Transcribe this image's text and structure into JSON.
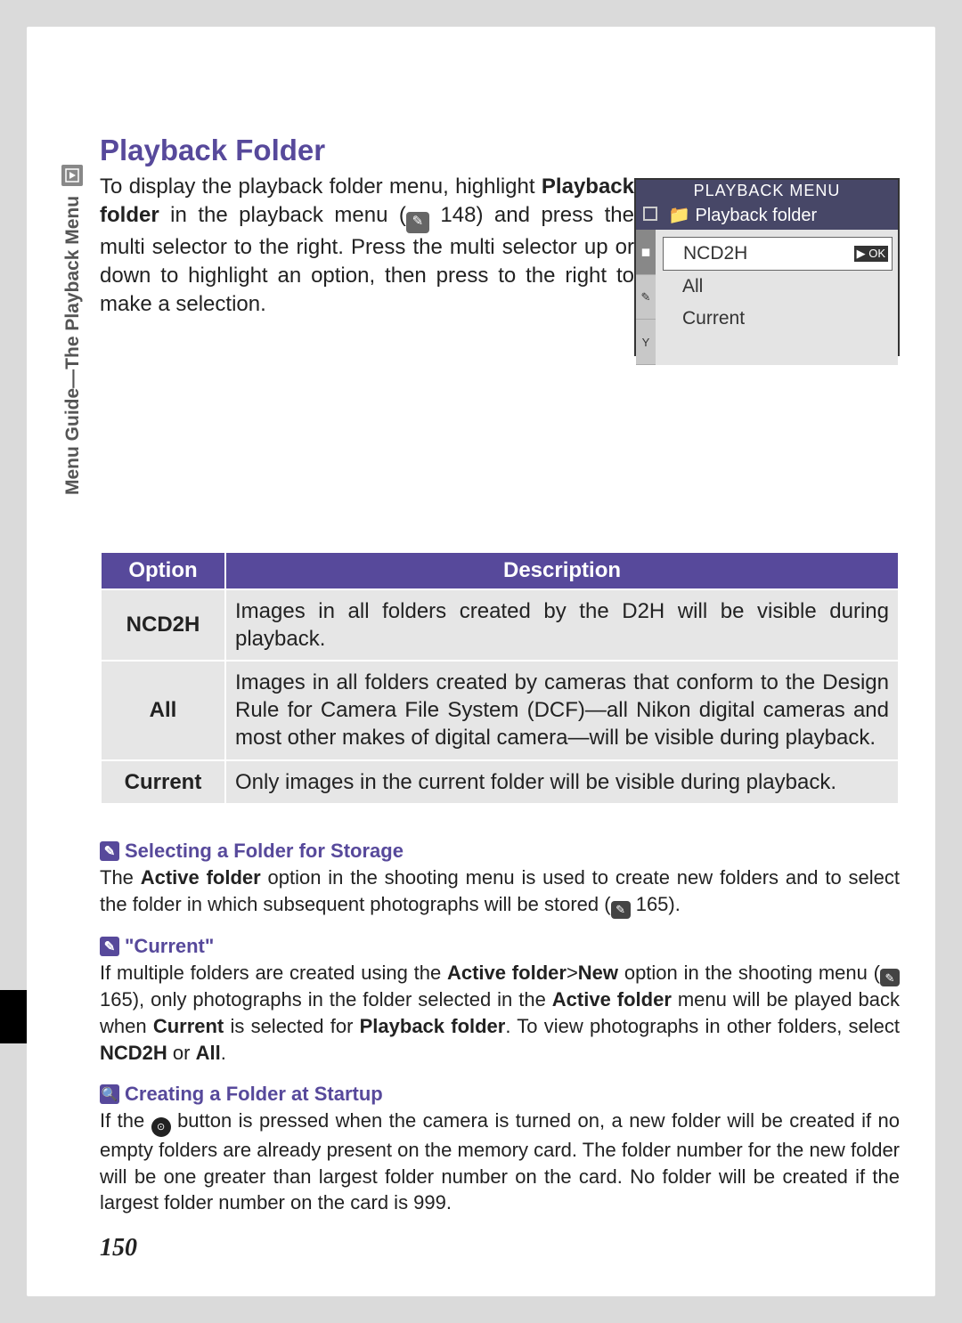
{
  "side_label": "Menu Guide—The Playback Menu",
  "heading": "Playback Folder",
  "intro": {
    "pre": "To display the playback folder menu, highlight ",
    "bold1": "Playback folder",
    "mid1": " in the playback menu (",
    "ref1": "148",
    "post": ") and press the multi selector to the right.  Press the multi selector up or down to highlight an option, then press to the right to make a selection."
  },
  "lcd": {
    "title": "PLAYBACK MENU",
    "subtitle": "Playback folder",
    "items": [
      "NCD2H",
      "All",
      "Current"
    ],
    "ok": "OK"
  },
  "table": {
    "head_option": "Option",
    "head_desc": "Description",
    "rows": [
      {
        "opt": "NCD2H",
        "desc": "Images in all folders created by the D2H will be visible during playback."
      },
      {
        "opt": "All",
        "desc": "Images in all folders created by cameras that conform to the Design Rule for Camera File System (DCF)—all Nikon digital cameras and most other makes of digital camera—will be visible during playback."
      },
      {
        "opt": "Current",
        "desc": "Only images in the current folder will be visible during playback."
      }
    ]
  },
  "note1": {
    "title": "Selecting a Folder for Storage",
    "pre": "The ",
    "b1": "Active folder",
    "mid": " option in the shooting menu is used to create new folders and to select the folder in which subsequent photographs will be stored (",
    "ref": "165",
    "post": ")."
  },
  "note2": {
    "title": "\"Current\"",
    "pre": "If multiple folders are created using the ",
    "b1": "Active folder",
    "gt": ">",
    "b2": "New",
    "mid1": " option in the shooting menu (",
    "ref": "165",
    "mid2": "), only photographs in the folder selected in the ",
    "b3": "Active folder",
    "mid3": " menu will be played back when ",
    "b4": "Current",
    "mid4": " is selected for ",
    "b5": "Playback folder",
    "mid5": ".  To view photographs in other folders, select ",
    "b6": "NCD2H",
    "or": " or ",
    "b7": "All",
    "post": "."
  },
  "note3": {
    "title": "Creating a Folder at Startup",
    "pre": "If the ",
    "mid": " button is pressed when the camera is turned on, a new folder will be created if no empty folders are already present on the memory card.  The folder number for the new folder will be one greater than largest folder number on the card.  No folder will be created if the largest folder number on the card is 999."
  },
  "page_number": "150"
}
